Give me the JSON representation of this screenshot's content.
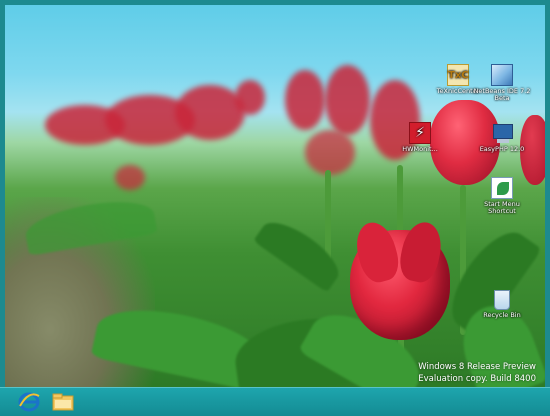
{
  "desktop": {
    "icons": [
      {
        "name": "texniccenter",
        "label": "TeXnicCenter"
      },
      {
        "name": "netbeans",
        "label": "NetBeans IDE 7.2 Beta"
      },
      {
        "name": "hwmonitor",
        "label": "HWMonit..."
      },
      {
        "name": "easyphp",
        "label": "EasyPHP 12.0"
      },
      {
        "name": "start-menu",
        "label": "Start Menu Shortcut"
      },
      {
        "name": "recycle-bin",
        "label": "Recycle Bin"
      }
    ],
    "watermark": {
      "line1": "Windows 8 Release Preview",
      "line2": "Evaluation copy. Build 8400"
    }
  },
  "taskbar": {
    "pinned": [
      {
        "name": "internet-explorer",
        "icon": "ie-icon"
      },
      {
        "name": "file-explorer",
        "icon": "folder-icon"
      }
    ]
  },
  "colors": {
    "taskbar": "#138b93",
    "frame": "#1d8a8f",
    "tulip": "#d9233a"
  }
}
